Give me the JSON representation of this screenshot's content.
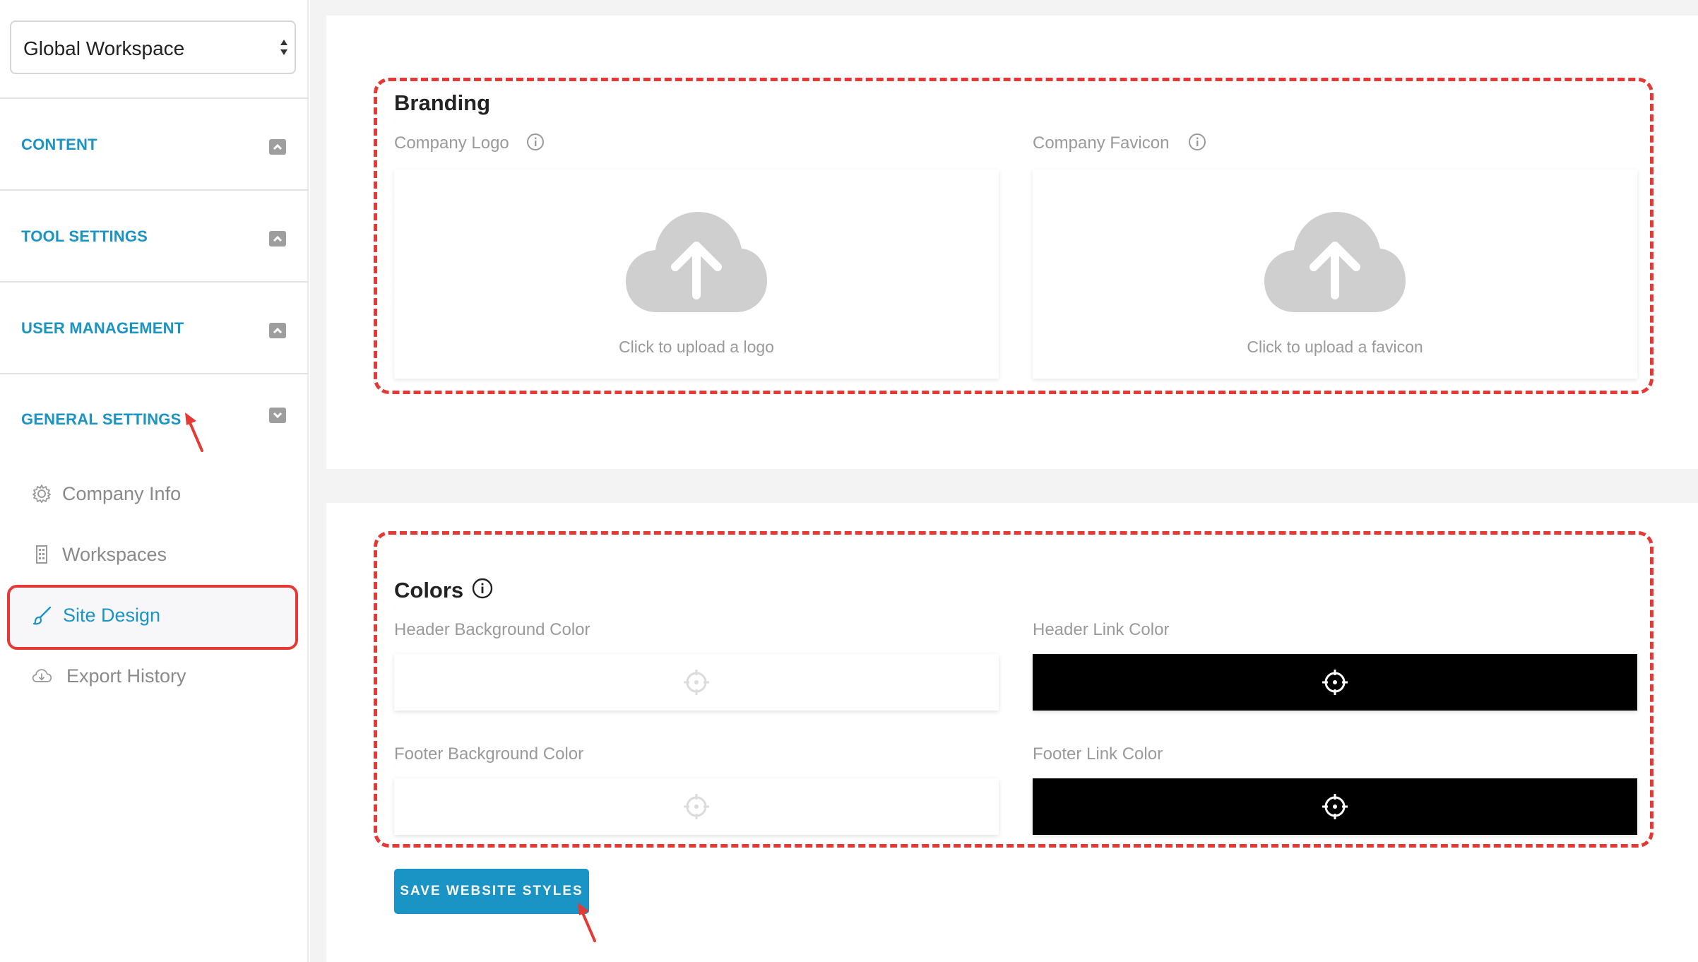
{
  "sidebar": {
    "workspace_select": {
      "value": "Global Workspace"
    },
    "sections": [
      {
        "label": "CONTENT",
        "state": "collapsed"
      },
      {
        "label": "TOOL SETTINGS",
        "state": "collapsed"
      },
      {
        "label": "USER MANAGEMENT",
        "state": "collapsed"
      },
      {
        "label": "GENERAL SETTINGS",
        "state": "expanded"
      }
    ],
    "subnav": [
      {
        "label": "Company Info",
        "icon": "gear-icon"
      },
      {
        "label": "Workspaces",
        "icon": "building-icon"
      },
      {
        "label": "Site Design",
        "icon": "brush-icon",
        "active": true
      },
      {
        "label": "Export History",
        "icon": "cloud-download-icon"
      }
    ]
  },
  "branding": {
    "title": "Branding",
    "logo": {
      "label": "Company Logo",
      "upload_text": "Click to upload a logo"
    },
    "favicon": {
      "label": "Company Favicon",
      "upload_text": "Click to upload a favicon"
    }
  },
  "colors": {
    "title": "Colors",
    "header_bg": {
      "label": "Header Background Color",
      "value": "#ffffff"
    },
    "header_link": {
      "label": "Header Link Color",
      "value": "#000000"
    },
    "footer_bg": {
      "label": "Footer Background Color",
      "value": "#ffffff"
    },
    "footer_link": {
      "label": "Footer Link Color",
      "value": "#000000"
    }
  },
  "actions": {
    "save_label": "SAVE WEBSITE STYLES"
  },
  "theme": {
    "accent": "#1a94c4",
    "annotation": "#e53935"
  }
}
